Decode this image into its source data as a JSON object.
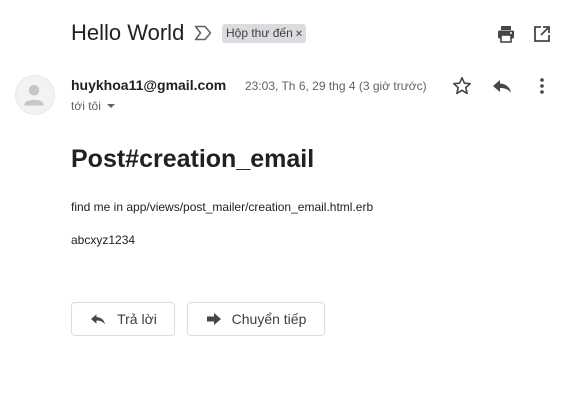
{
  "email": {
    "subject": "Hello World",
    "label": "Hộp thư đến",
    "label_remove": "×",
    "sender": "huykhoa11@gmail.com",
    "recipient": "tới tôi",
    "date": "23:03, Th 6, 29 thg 4 (3 giờ trước)",
    "body": {
      "heading": "Post#creation_email",
      "line1": "find me in app/views/post_mailer/creation_email.html.erb",
      "line2": "abcxyz1234"
    }
  },
  "actions": {
    "reply_label": "Trả lời",
    "forward_label": "Chuyển tiếp"
  },
  "icons": {
    "importance": "importance-marker-icon",
    "print": "print-icon",
    "open_new_window": "open-in-new-window-icon",
    "star": "star-icon",
    "reply": "reply-icon",
    "more": "more-vert-icon",
    "forward": "forward-icon",
    "avatar": "avatar-icon"
  },
  "colors": {
    "text_primary": "#202124",
    "text_secondary": "#5f6368",
    "chip_bg": "#dadce0",
    "icon": "#444746",
    "border": "#dadce0"
  }
}
